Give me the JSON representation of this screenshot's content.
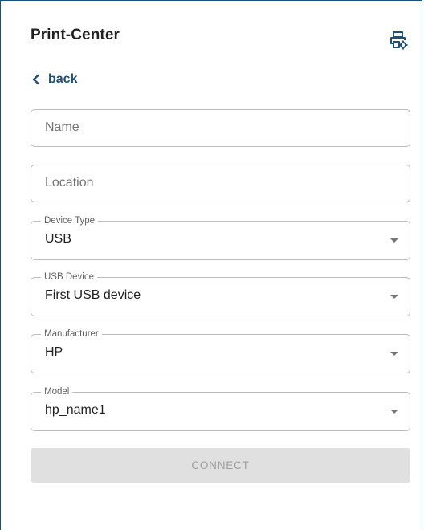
{
  "header": {
    "title": "Print-Center",
    "settings_icon": "printer-settings-icon"
  },
  "nav": {
    "back_label": "back",
    "back_icon": "chevron-left-icon"
  },
  "form": {
    "name": {
      "placeholder": "Name",
      "value": ""
    },
    "location": {
      "placeholder": "Location",
      "value": ""
    },
    "device_type": {
      "label": "Device Type",
      "value": "USB"
    },
    "usb_device": {
      "label": "USB Device",
      "value": "First USB device"
    },
    "manufacturer": {
      "label": "Manufacturer",
      "value": "HP"
    },
    "model": {
      "label": "Model",
      "value": "hp_name1"
    },
    "connect_label": "CONNECT",
    "connect_enabled": false
  },
  "colors": {
    "accent": "#1f4e79",
    "border": "#bdbdbd",
    "button_disabled_bg": "#e0e0e0",
    "button_disabled_text": "#9e9e9e"
  }
}
